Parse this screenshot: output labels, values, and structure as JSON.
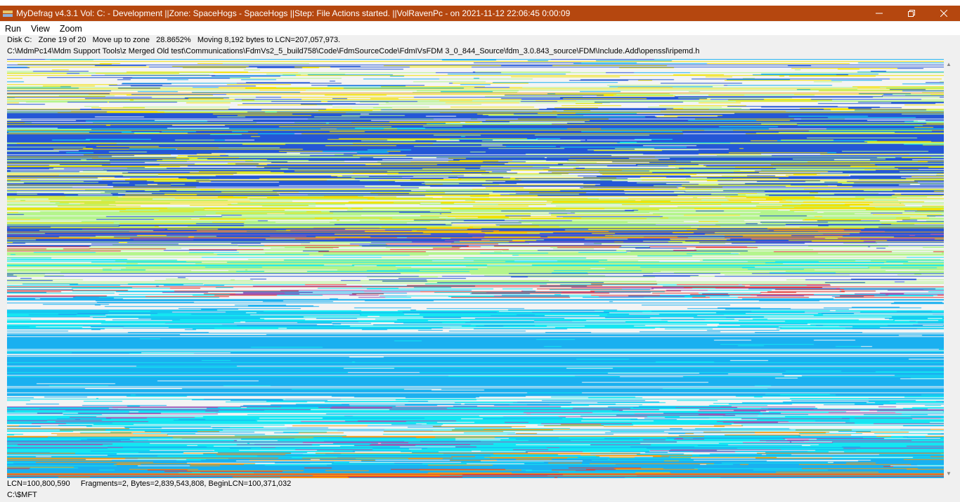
{
  "window": {
    "title": "MyDefrag v4.3.1   Vol: C: - Development ||Zone: SpaceHogs - SpaceHogs ||Step: File Actions started. ||VolRavenPc -   on 2021-11-12 22:06:45 0:00:09",
    "icon": "mydefrag-app-icon",
    "titlebar_color": "#b5470f"
  },
  "menu": {
    "items": [
      "Run",
      "View",
      "Zoom"
    ]
  },
  "status": {
    "line1": "Disk C:   Zone 19 of 20   Move up to zone   28.8652%   Moving 8,192 bytes to LCN=207,057,973.",
    "line2": "C:\\MdmPc14\\Mdm Support Tools\\z Merged Old test\\Communications\\FdmVs2_5_build758\\Code\\FdmSourceCode\\FdmIVsFDM 3_0_844_Source\\fdm_3.0.843_source\\FDM\\Include.Add\\openssl\\ripemd.h"
  },
  "footer": {
    "line1": "LCN=100,800,590     Fragments=2, Bytes=2,839,543,808, BeginLCN=100,371,032",
    "line2": "C:\\$MFT"
  },
  "diskmap": {
    "colors": {
      "background": "#f4f4f4",
      "files_blue": "#2457d6",
      "spacehogs_lightblue": "#1ab0f0",
      "cyan": "#14e6f2",
      "lime": "#b4f58c",
      "yellow": "#f2e100",
      "orange": "#f39c12",
      "purple": "#9b59b6",
      "red": "#e53935"
    }
  },
  "scrollbar": {
    "up_icon": "scroll-up-arrow-icon",
    "down_icon": "scroll-down-arrow-icon"
  }
}
